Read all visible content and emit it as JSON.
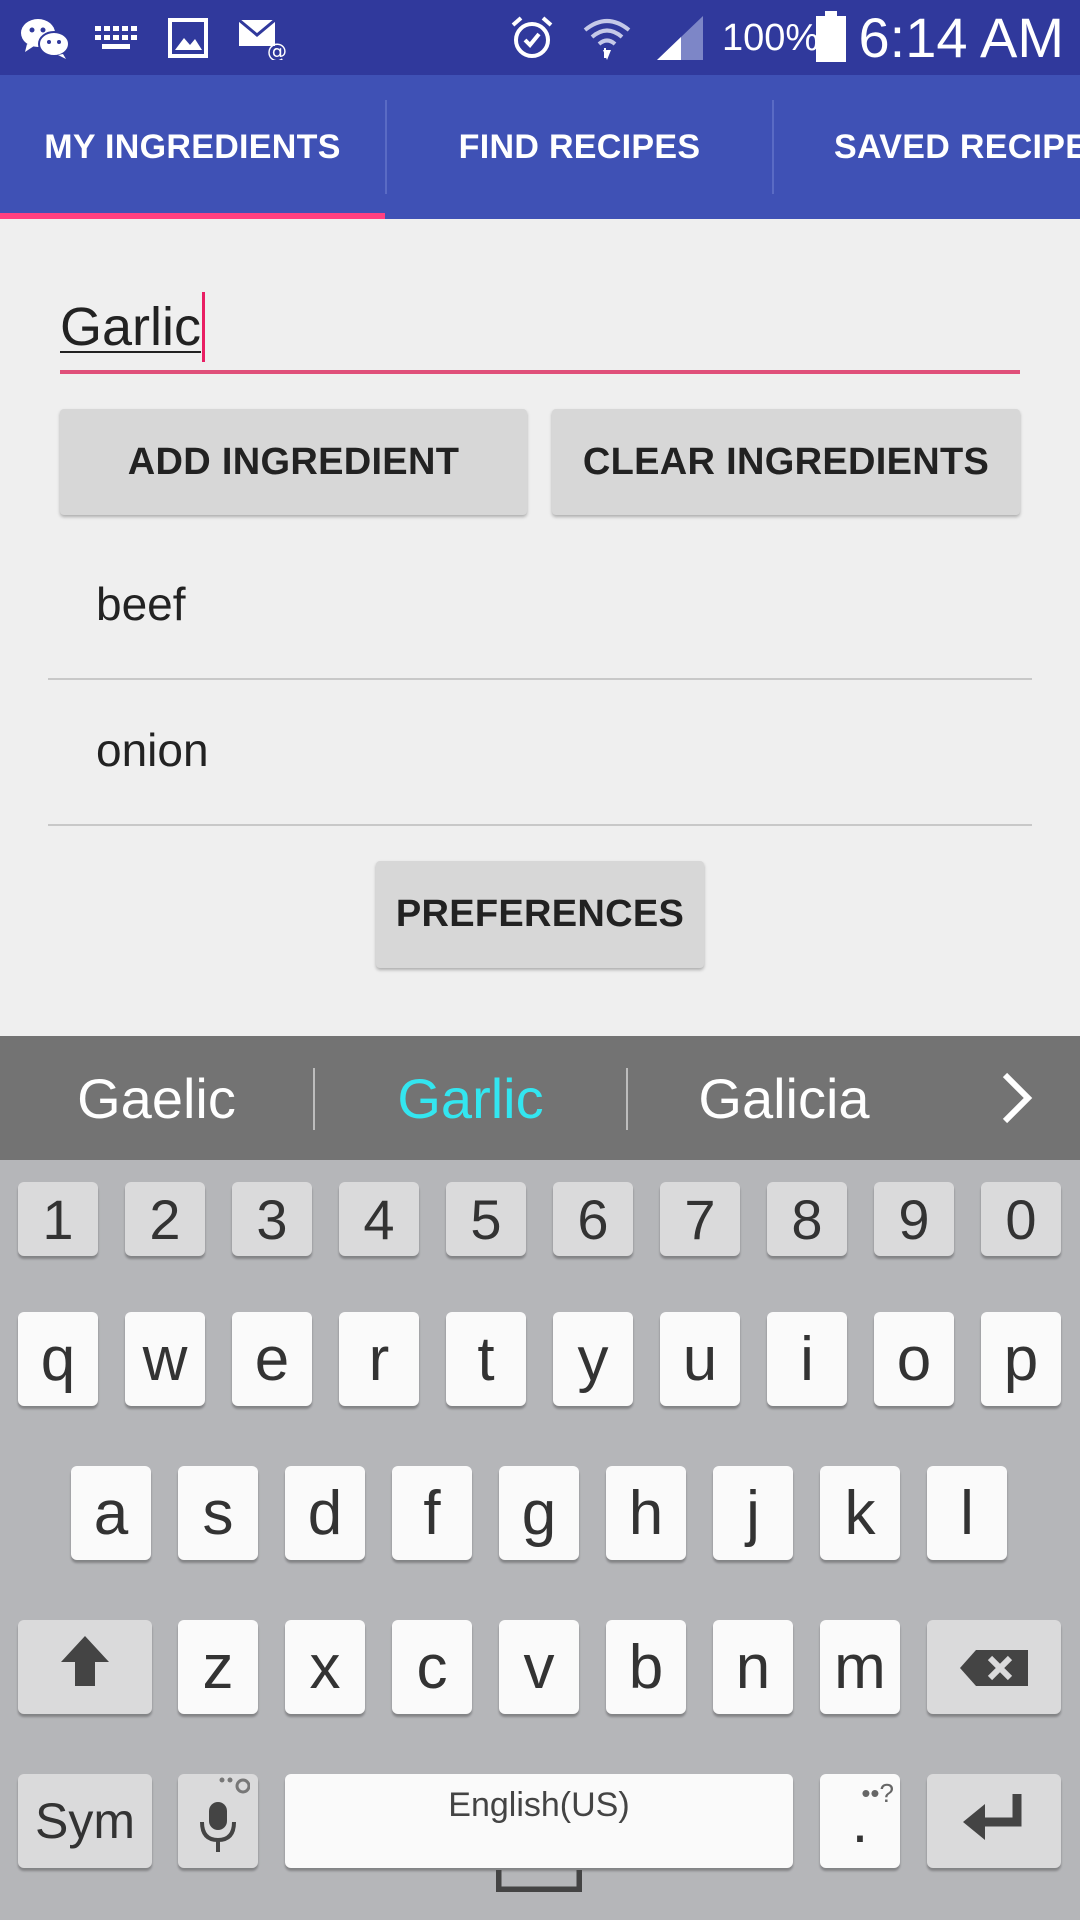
{
  "status_bar": {
    "icons": [
      "wechat-icon",
      "keyboard-icon",
      "image-icon",
      "email-icon",
      "alarm-icon",
      "wifi-icon",
      "signal-icon",
      "battery-icon"
    ],
    "battery": "100%",
    "time": "6:14 AM"
  },
  "tabs": [
    {
      "label": "MY INGREDIENTS",
      "selected": true
    },
    {
      "label": "FIND RECIPES",
      "selected": false
    },
    {
      "label": "SAVED RECIPES",
      "selected": false
    }
  ],
  "ingredient_input": {
    "value": "Garlic"
  },
  "buttons": {
    "add": "ADD INGREDIENT",
    "clear": "CLEAR INGREDIENTS",
    "preferences": "PREFERENCES"
  },
  "ingredients": [
    "beef",
    "onion"
  ],
  "suggestions": [
    {
      "text": "Gaelic",
      "highlighted": false
    },
    {
      "text": "Garlic",
      "highlighted": true
    },
    {
      "text": "Galicia",
      "highlighted": false
    }
  ],
  "keyboard": {
    "numbers": [
      "1",
      "2",
      "3",
      "4",
      "5",
      "6",
      "7",
      "8",
      "9",
      "0"
    ],
    "row1": [
      "q",
      "w",
      "e",
      "r",
      "t",
      "y",
      "u",
      "i",
      "o",
      "p"
    ],
    "row2": [
      "a",
      "s",
      "d",
      "f",
      "g",
      "h",
      "j",
      "k",
      "l"
    ],
    "row3": [
      "z",
      "x",
      "c",
      "v",
      "b",
      "n",
      "m"
    ],
    "sym": "Sym",
    "space": "English(US)",
    "period": "."
  },
  "colors": {
    "primary": "#3f51b5",
    "primary_dark": "#30399c",
    "accent": "#ff4081",
    "suggest_highlight": "#33e6f0"
  }
}
